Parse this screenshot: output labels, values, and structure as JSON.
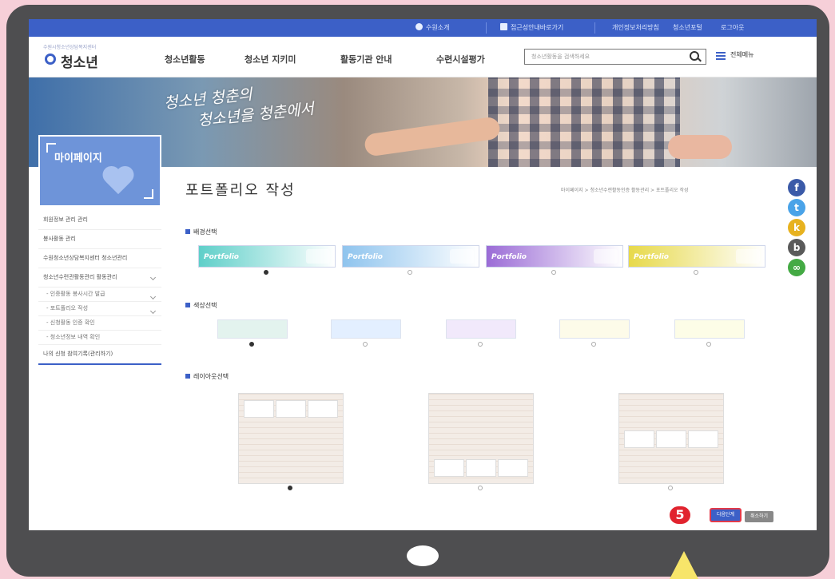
{
  "topbar": {
    "items": [
      "수원소개",
      "접근성안내바로가기",
      "개인정보처리방침",
      "청소년포털",
      "로그아웃"
    ]
  },
  "header": {
    "logo_sub": "수원시청소년상담복지센터",
    "logo_text": "청소년",
    "nav": [
      "청소년활동",
      "청소년 지키미",
      "활동기관 안내",
      "수련시설평가"
    ],
    "search_placeholder": "청소년활동을 검색하세요",
    "menu_label": "전체메뉴"
  },
  "hero": {
    "script_line1": "청소년 청춘의",
    "script_line2": "청소년을 청춘에서"
  },
  "sidebar": {
    "title": "마이페이지",
    "items": [
      {
        "label": "회원정보 관리 관리",
        "sub": false,
        "chevron": false
      },
      {
        "label": "봉사활동 관리",
        "sub": false,
        "chevron": false
      },
      {
        "label": "수원청소년상담복지센터 청소년관리",
        "sub": false,
        "chevron": false
      },
      {
        "label": "청소년수련관활동관리 활동관리",
        "sub": false,
        "chevron": true
      },
      {
        "label": "- 인증활동 봉사시간 발급",
        "sub": true,
        "chevron": true
      },
      {
        "label": "- 포트폴리오 작성",
        "sub": true,
        "chevron": true
      },
      {
        "label": "- 신청활동 인증 확인",
        "sub": true,
        "chevron": false
      },
      {
        "label": "- 청소년정보 내역 확인",
        "sub": true,
        "chevron": false
      },
      {
        "label": "나의 신청 참여기록(관리하기)",
        "sub": false,
        "chevron": false
      }
    ]
  },
  "content": {
    "page_title": "포트폴리오 작성",
    "breadcrumb": "마이페이지 > 청소년수련활동인증 활동관리 > 포트폴리오 작성",
    "section1_title": "배경선택",
    "banner_word": "Portfolio",
    "section2_title": "색상선택",
    "section3_title": "레이아웃선택",
    "banner_colors": [
      "#5fcfc9",
      "#8fc4ee",
      "#9b6cd6",
      "#e7d94a"
    ],
    "swatch_colors": [
      "#e3f3ee",
      "#e3efff",
      "#f1e9fb",
      "#fdfbe9",
      "#fdfde7"
    ]
  },
  "actions": {
    "step_number": "5",
    "primary_label": "다음단계",
    "secondary_label": "취소하기"
  },
  "social": [
    {
      "name": "facebook-icon",
      "glyph": "f",
      "color": "#3b5aa8"
    },
    {
      "name": "twitter-icon",
      "glyph": "t",
      "color": "#4aa3e8"
    },
    {
      "name": "kakaostory-icon",
      "glyph": "k",
      "color": "#e7b21f"
    },
    {
      "name": "blog-icon",
      "glyph": "b",
      "color": "#5a5a5a"
    },
    {
      "name": "link-icon",
      "glyph": "∞",
      "color": "#44aa44"
    }
  ]
}
